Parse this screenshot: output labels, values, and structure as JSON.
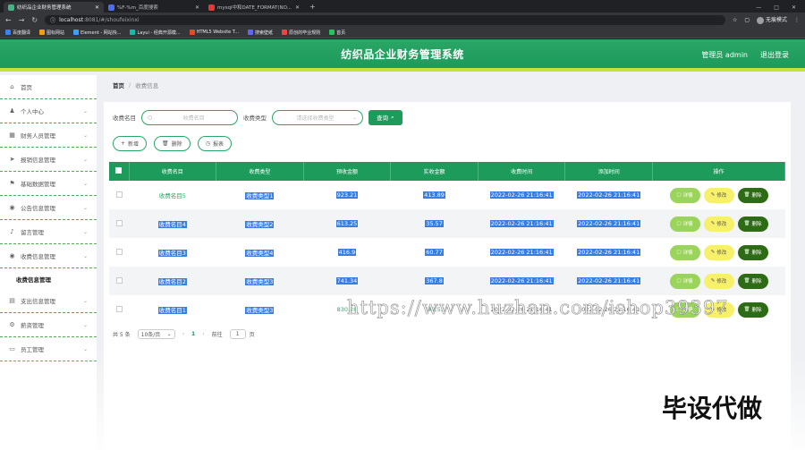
{
  "browser": {
    "tabs": [
      {
        "title": "纺织品企业财务管理系统",
        "color": "#41b883",
        "active": true
      },
      {
        "title": "%F-%m_百度搜索",
        "color": "#4e6ef2",
        "active": false
      },
      {
        "title": "mysql中和DATE_FORMAT(NO...",
        "color": "#e53935",
        "active": false
      }
    ],
    "url_host": "localhost",
    "url_rest": ":8081/#/shoufeixinxi",
    "profile_label": "无痕模式",
    "bookmarks": [
      {
        "label": "百度翻译",
        "color": "#3b82f6"
      },
      {
        "label": "图标网站",
        "color": "#f59e0b"
      },
      {
        "label": "Element - 网站快...",
        "color": "#409eff"
      },
      {
        "label": "Layui - 经典开源模...",
        "color": "#16baaa"
      },
      {
        "label": "HTML5 Website T...",
        "color": "#e34c26"
      },
      {
        "label": "搜索壁纸",
        "color": "#6366f1"
      },
      {
        "label": "原创的毕业规则",
        "color": "#ef4444"
      },
      {
        "label": "首页",
        "color": "#22c55e"
      }
    ]
  },
  "header": {
    "title": "纺织品企业财务管理系统",
    "user": "管理员 admin",
    "logout": "退出登录"
  },
  "sidebar": {
    "items": [
      {
        "label": "首页",
        "icon": "home-icon",
        "glyph": "⌂",
        "chev": false
      },
      {
        "label": "个人中心",
        "icon": "user-icon",
        "glyph": "♟",
        "chev": true
      },
      {
        "label": "财务人员管理",
        "icon": "grid-icon",
        "glyph": "▦",
        "chev": true
      },
      {
        "label": "报销信息管理",
        "icon": "send-icon",
        "glyph": "➤",
        "chev": true
      },
      {
        "label": "基础数据管理",
        "icon": "flag-icon",
        "glyph": "⚑",
        "chev": true
      },
      {
        "label": "公告信息管理",
        "icon": "location-icon",
        "glyph": "◉",
        "chev": true
      },
      {
        "label": "留言管理",
        "icon": "microphone-icon",
        "glyph": "♪",
        "chev": true
      },
      {
        "label": "收费信息管理",
        "icon": "location-icon",
        "glyph": "◉",
        "chev": true
      }
    ],
    "subitem": "收费信息管理",
    "items_after": [
      {
        "label": "支出信息管理",
        "icon": "document-icon",
        "glyph": "▤",
        "chev": true
      },
      {
        "label": "薪资管理",
        "icon": "settings-icon",
        "glyph": "⚙",
        "chev": true
      },
      {
        "label": "员工管理",
        "icon": "monitor-icon",
        "glyph": "▭",
        "chev": true
      }
    ]
  },
  "breadcrumb": {
    "home": "首页",
    "sep": "/",
    "current": "收费信息"
  },
  "search": {
    "name_label": "收费名目",
    "name_placeholder": "收费名目",
    "type_label": "收费类型",
    "type_placeholder": "请选择收费类型",
    "button": "查询"
  },
  "actions": {
    "add": "新增",
    "delete": "删除",
    "report": "报表"
  },
  "table": {
    "headers": [
      "收费名目",
      "收费类型",
      "预收金额",
      "实收金额",
      "收费时间",
      "添加时间",
      "操作"
    ],
    "rows": [
      {
        "name": "收费名目5",
        "type": "收费类型1",
        "pre": "923.21",
        "actual": "413.89",
        "time": "2022-02-26 21:16:41",
        "added": "2022-02-26 21:16:41",
        "hl": [
          false,
          true,
          true,
          true,
          true,
          true
        ]
      },
      {
        "name": "收费名目4",
        "type": "收费类型2",
        "pre": "613.25",
        "actual": "35.57",
        "time": "2022-02-26 21:16:41",
        "added": "2022-02-26 21:16:41",
        "hl": [
          true,
          true,
          true,
          true,
          true,
          true
        ]
      },
      {
        "name": "收费名目3",
        "type": "收费类型4",
        "pre": "416.9",
        "actual": "60.77",
        "time": "2022-02-26 21:16:41",
        "added": "2022-02-26 21:16:41",
        "hl": [
          true,
          true,
          true,
          true,
          true,
          true
        ]
      },
      {
        "name": "收费名目2",
        "type": "收费类型3",
        "pre": "741.34",
        "actual": "367.8",
        "time": "2022-02-26 21:16:41",
        "added": "2022-02-26 21:16:41",
        "hl": [
          true,
          true,
          true,
          true,
          true,
          true
        ]
      },
      {
        "name": "收费名目1",
        "type": "收费类型3",
        "pre": "830.28",
        "actual": "742.53",
        "time": "2022-02-26 21:16:41",
        "added": "2022-02-26 21:16:41",
        "hl": [
          true,
          true,
          false,
          false,
          false,
          false
        ]
      }
    ],
    "op_detail": "详情",
    "op_edit": "修改",
    "op_delete": "删除"
  },
  "pager": {
    "total": "共 5 条",
    "size": "10条/页",
    "prev": "‹",
    "current": "1",
    "next": "›",
    "goto": "前往",
    "goto_val": "1",
    "page_unit": "页"
  },
  "overlay": {
    "watermark": "https://www.huzhan.com/ishop39397",
    "corner": "毕设代做"
  }
}
